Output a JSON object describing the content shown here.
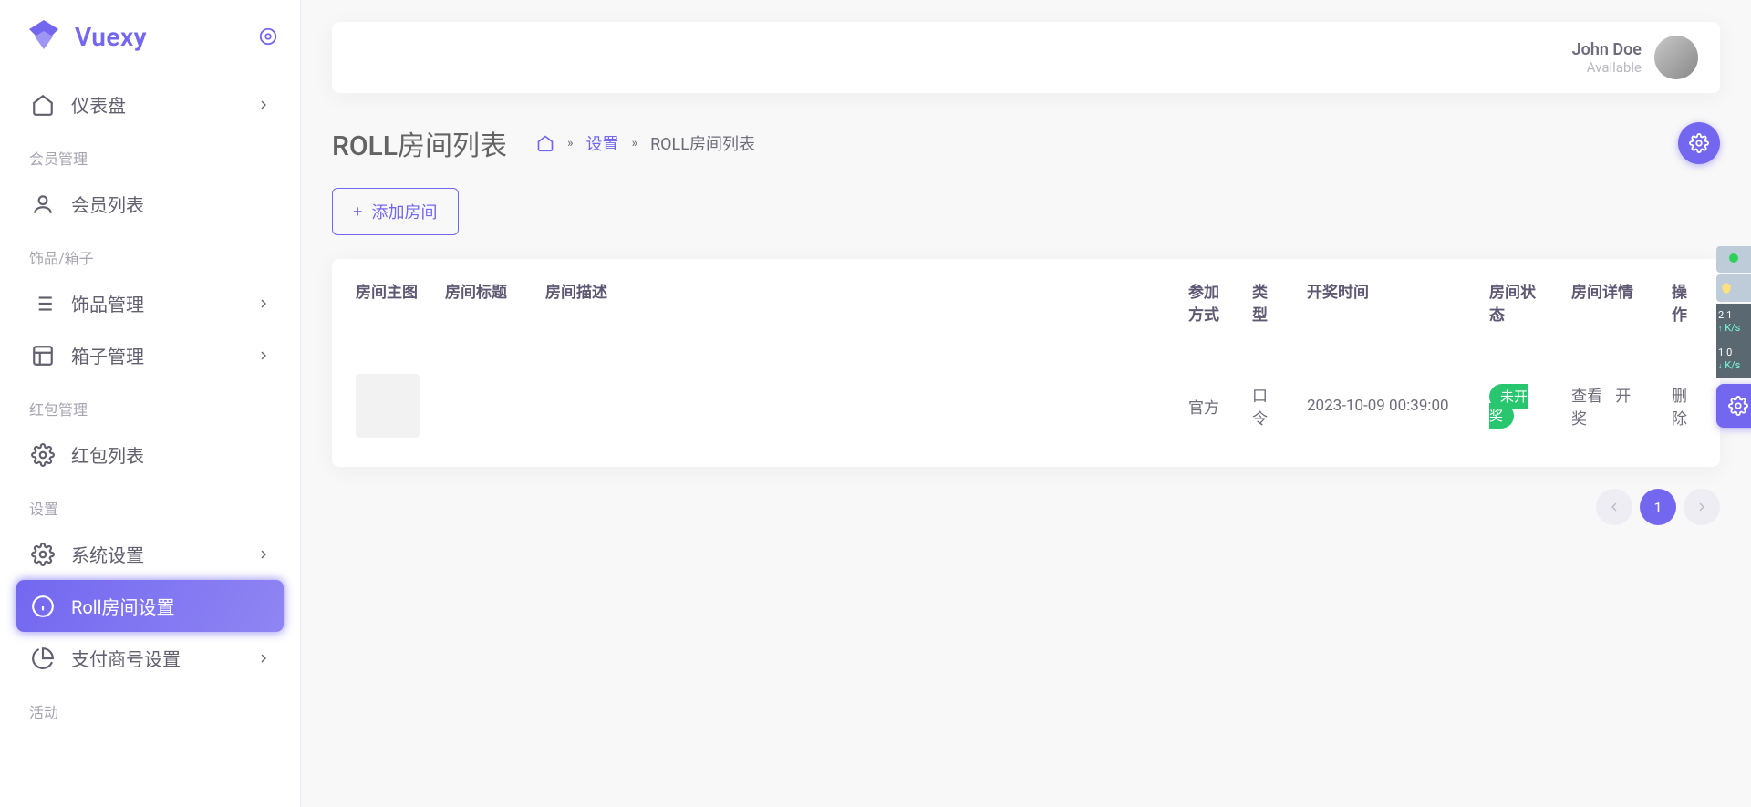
{
  "brand": {
    "name": "Vuexy"
  },
  "user": {
    "name": "John Doe",
    "status": "Available"
  },
  "sidebar": {
    "dashboard": "仪表盘",
    "sections": {
      "member": "会员管理",
      "ornament": "饰品/箱子",
      "redpack": "红包管理",
      "settings": "设置",
      "activity": "活动"
    },
    "items": {
      "memberList": "会员列表",
      "ornamentMgmt": "饰品管理",
      "boxMgmt": "箱子管理",
      "redpackList": "红包列表",
      "sysSettings": "系统设置",
      "rollRoom": "Roll房间设置",
      "payment": "支付商号设置"
    }
  },
  "page": {
    "title": "ROLL房间列表",
    "breadcrumb": {
      "settings": "设置",
      "current": "ROLL房间列表"
    },
    "addBtn": "添加房间"
  },
  "table": {
    "headers": {
      "thumb": "房间主图",
      "title": "房间标题",
      "desc": "房间描述",
      "joinMode": "参加方式",
      "type": "类型",
      "drawTime": "开奖时间",
      "status": "房间状态",
      "detail": "房间详情",
      "ops": "操作"
    },
    "rows": [
      {
        "title": "",
        "desc": "",
        "joinMode": "官方",
        "type": "口令",
        "drawTime": "2023-10-09 00:39:00",
        "status": "未开奖",
        "actions": {
          "view": "查看",
          "draw": "开奖",
          "delete": "删除"
        }
      }
    ]
  },
  "pagination": {
    "current": "1"
  },
  "gadgets": {
    "up": "2.1",
    "upUnit": "K/s",
    "down": "1.0",
    "downUnit": "K/s"
  }
}
